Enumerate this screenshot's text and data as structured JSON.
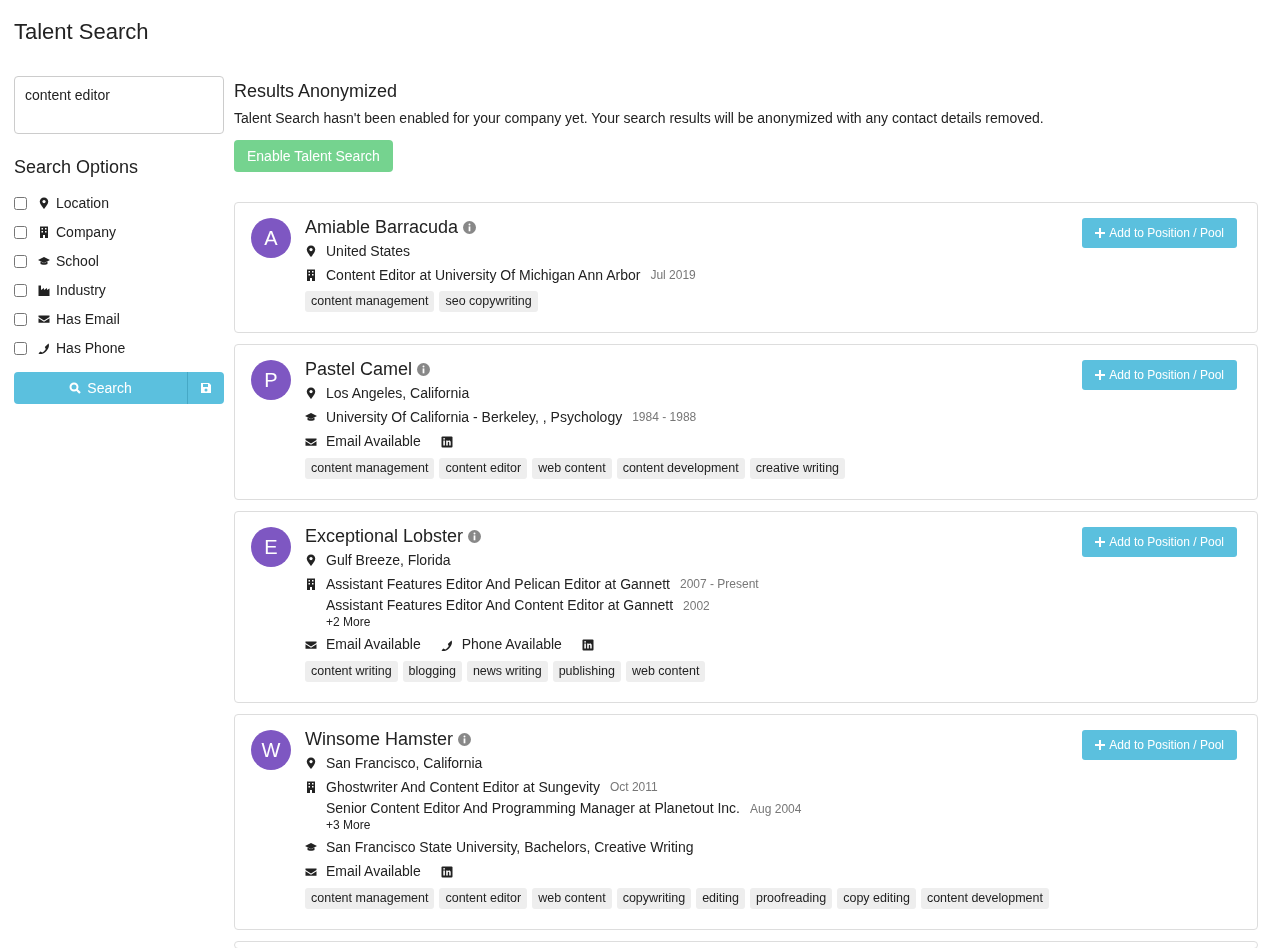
{
  "page_title": "Talent Search",
  "search": {
    "value": "content editor"
  },
  "options_title": "Search Options",
  "options": [
    {
      "kind": "location",
      "label": "Location",
      "checked": false
    },
    {
      "kind": "company",
      "label": "Company",
      "checked": false
    },
    {
      "kind": "school",
      "label": "School",
      "checked": false
    },
    {
      "kind": "industry",
      "label": "Industry",
      "checked": false
    },
    {
      "kind": "email",
      "label": "Has Email",
      "checked": false
    },
    {
      "kind": "phone",
      "label": "Has Phone",
      "checked": false
    }
  ],
  "search_button": "Search",
  "notice": {
    "title": "Results Anonymized",
    "text": "Talent Search hasn't been enabled for your company yet. Your search results will be anonymized with any contact details removed.",
    "button": "Enable Talent Search"
  },
  "candidates": [
    {
      "add_button": "Add to Position / Pool",
      "initial": "A",
      "name": "Amiable Barracuda",
      "location": "United States",
      "jobs": [
        {
          "title": "Content Editor at University Of Michigan Ann Arbor",
          "dates": "Jul 2019"
        }
      ],
      "tags": [
        "content management",
        "seo copywriting"
      ]
    },
    {
      "add_button": "Add to Position / Pool",
      "initial": "P",
      "name": "Pastel Camel",
      "location": "Los Angeles, California",
      "education": [
        {
          "text": "University Of California - Berkeley, , Psychology",
          "dates": "1984 - 1988"
        }
      ],
      "contacts": [
        {
          "kind": "email",
          "label": "Email Available"
        },
        {
          "kind": "linkedin"
        }
      ],
      "tags": [
        "content management",
        "content editor",
        "web content",
        "content development",
        "creative writing"
      ]
    },
    {
      "add_button": "Add to Position / Pool",
      "initial": "E",
      "name": "Exceptional Lobster",
      "location": "Gulf Breeze, Florida",
      "jobs": [
        {
          "title": "Assistant Features Editor And Pelican Editor at Gannett",
          "dates": "2007 - Present"
        },
        {
          "title": "Assistant Features Editor And Content Editor at Gannett",
          "dates": "2002"
        }
      ],
      "more": "+2 More",
      "contacts": [
        {
          "kind": "email",
          "label": "Email Available"
        },
        {
          "kind": "phone",
          "label": "Phone Available"
        },
        {
          "kind": "linkedin"
        }
      ],
      "tags": [
        "content writing",
        "blogging",
        "news writing",
        "publishing",
        "web content"
      ]
    },
    {
      "add_button": "Add to Position / Pool",
      "initial": "W",
      "name": "Winsome Hamster",
      "location": "San Francisco, California",
      "jobs": [
        {
          "title": "Ghostwriter And Content Editor at Sungevity",
          "dates": "Oct 2011"
        },
        {
          "title": "Senior Content Editor And Programming Manager at Planetout Inc.",
          "dates": "Aug 2004"
        }
      ],
      "more": "+3 More",
      "education": [
        {
          "text": "San Francisco State University, Bachelors, Creative Writing"
        }
      ],
      "contacts": [
        {
          "kind": "email",
          "label": "Email Available"
        },
        {
          "kind": "linkedin"
        }
      ],
      "tags": [
        "content management",
        "content editor",
        "web content",
        "copywriting",
        "editing",
        "proofreading",
        "copy editing",
        "content development"
      ]
    }
  ]
}
